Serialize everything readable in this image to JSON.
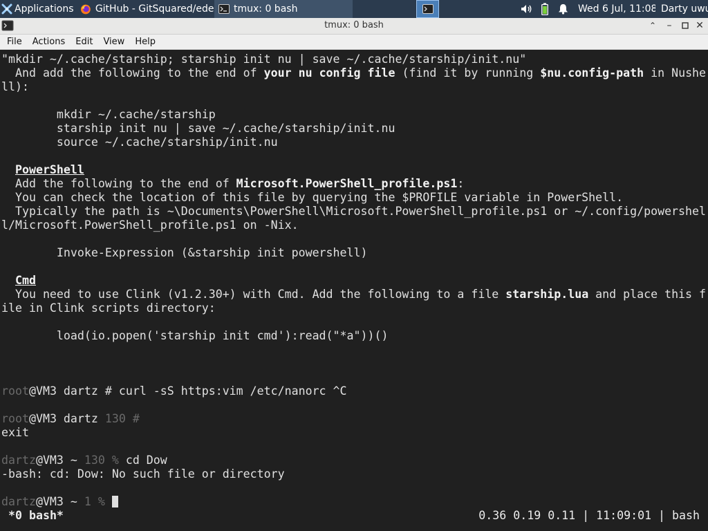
{
  "panel": {
    "apps_label": "Applications",
    "tasks": [
      {
        "label": "GitHub - GitSquared/ede...",
        "icon": "firefox-icon"
      },
      {
        "label": "tmux: 0 bash",
        "icon": "terminal-icon"
      }
    ],
    "clock": "Wed  6 Jul, 11:08",
    "user": "Darty uwu",
    "tray_icons": [
      "volume-icon",
      "battery-icon",
      "notification-bell-icon"
    ]
  },
  "window": {
    "title": "tmux: 0 bash",
    "buttons": [
      "maximize-up",
      "minimize",
      "restore",
      "close"
    ]
  },
  "menu": {
    "file": "File",
    "actions": "Actions",
    "edit": "Edit",
    "view": "View",
    "help": "Help"
  },
  "terminal": {
    "lines": [
      [
        {
          "t": "\"mkdir ~/.cache/starship; starship init nu | save ~/.cache/starship/init.nu\""
        }
      ],
      [
        {
          "t": "  And add the following to the end of "
        },
        {
          "t": "your nu config file",
          "s": "b"
        },
        {
          "t": " (find it by running "
        },
        {
          "t": "$nu.config-path",
          "s": "b"
        },
        {
          "t": " in Nushe"
        }
      ],
      [
        {
          "t": "ll):"
        }
      ],
      [],
      [
        {
          "t": "        mkdir ~/.cache/starship"
        }
      ],
      [
        {
          "t": "        starship init nu | save ~/.cache/starship/init.nu"
        }
      ],
      [
        {
          "t": "        source ~/.cache/starship/init.nu"
        }
      ],
      [],
      [
        {
          "t": "  "
        },
        {
          "t": "PowerShell",
          "s": "u"
        }
      ],
      [
        {
          "t": "  Add the following to the end of "
        },
        {
          "t": "Microsoft.PowerShell_profile.ps1",
          "s": "b"
        },
        {
          "t": ":"
        }
      ],
      [
        {
          "t": "  You can check the location of this file by querying the $PROFILE variable in PowerShell."
        }
      ],
      [
        {
          "t": "  Typically the path is ~\\Documents\\PowerShell\\Microsoft.PowerShell_profile.ps1 or ~/.config/powershel"
        }
      ],
      [
        {
          "t": "l/Microsoft.PowerShell_profile.ps1 on -Nix."
        }
      ],
      [],
      [
        {
          "t": "        Invoke-Expression (&starship init powershell)"
        }
      ],
      [],
      [
        {
          "t": "  "
        },
        {
          "t": "Cmd",
          "s": "u"
        }
      ],
      [
        {
          "t": "  You need to use Clink (v1.2.30+) with Cmd. Add the following to a file "
        },
        {
          "t": "starship.lua",
          "s": "b"
        },
        {
          "t": " and place this f"
        }
      ],
      [
        {
          "t": "ile in Clink scripts directory:"
        }
      ],
      [],
      [
        {
          "t": "        load(io.popen('starship init cmd'):read(\"*a\"))()"
        }
      ],
      [],
      [],
      [],
      [
        {
          "t": "root",
          "s": "dim"
        },
        {
          "t": "@VM3 dartz # curl -sS https:vim /etc/nanorc ^C"
        }
      ],
      [],
      [
        {
          "t": "root",
          "s": "dim"
        },
        {
          "t": "@VM3 dartz "
        },
        {
          "t": "130 #",
          "s": "dim"
        }
      ],
      [
        {
          "t": "exit"
        }
      ],
      [],
      [
        {
          "t": "dartz",
          "s": "dim"
        },
        {
          "t": "@VM3 ~ "
        },
        {
          "t": "130 %",
          "s": "dim"
        },
        {
          "t": " cd Dow"
        }
      ],
      [
        {
          "t": "-bash: cd: Dow: No such file or directory"
        }
      ],
      [],
      [
        {
          "t": "dartz",
          "s": "dim"
        },
        {
          "t": "@VM3 ~ "
        },
        {
          "t": "1 %",
          "s": "dim"
        },
        {
          "t": " "
        },
        {
          "t": "",
          "s": "cursor"
        }
      ]
    ]
  },
  "tmux_status": {
    "window": "*0 bash*",
    "right": "0.36 0.19 0.11 | 11:09:01 | bash"
  },
  "colors": {
    "panel_bg": "#2b3b4e",
    "terminal_bg": "#202020",
    "terminal_fg": "#e0e0e0",
    "prompt_dim": "#6a6a6a",
    "workspace_active": "#4a7fb8"
  }
}
